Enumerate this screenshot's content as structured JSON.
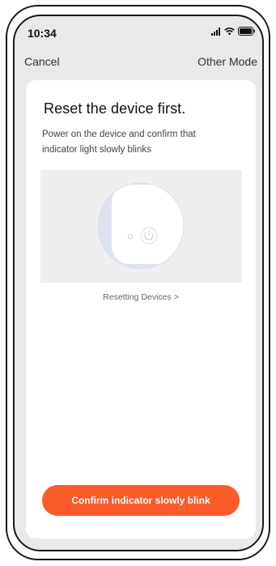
{
  "status_bar": {
    "time": "10:34",
    "icons": [
      "cellular-signal-icon",
      "wifi-icon",
      "battery-icon"
    ]
  },
  "nav": {
    "cancel_label": "Cancel",
    "other_mode_label": "Other Mode"
  },
  "card": {
    "title": "Reset the device first.",
    "description": "Power on the device and confirm that indicator light slowly blinks",
    "illustration_icons": [
      "indicator-light-icon",
      "power-icon"
    ],
    "resetting_link_label": "Resetting Devices >",
    "confirm_button_label": "Confirm indicator slowly blink"
  },
  "colors": {
    "accent": "#fb5a2b",
    "screen_background": "#e9e9ea",
    "card_background": "#ffffff",
    "illustration_background": "#efeff1"
  }
}
